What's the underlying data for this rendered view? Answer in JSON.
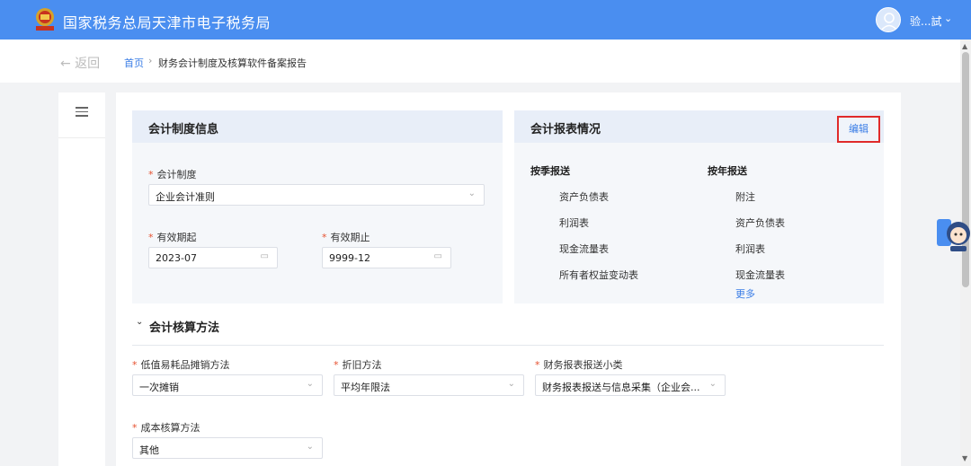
{
  "header": {
    "site_title": "国家税务总局天津市电子税务局",
    "username": "验...試",
    "brand_color": "#4a8ef0"
  },
  "breadcrumb": {
    "back_label": "← 返回",
    "home": "首页",
    "separator": "›",
    "current": "财务会计制度及核算软件备案报告"
  },
  "accounting_system": {
    "title": "会计制度信息",
    "system_label": "会计制度",
    "system_value": "企业会计准则",
    "start_label": "有效期起",
    "start_value": "2023-07",
    "end_label": "有效期止",
    "end_value": "9999-12"
  },
  "report_status": {
    "title": "会计报表情况",
    "edit_label": "编辑",
    "quarterly_head": "按季报送",
    "quarterly_items": [
      "资产负债表",
      "利润表",
      "现金流量表",
      "所有者权益变动表"
    ],
    "annual_head": "按年报送",
    "annual_items": [
      "附注",
      "资产负债表",
      "利润表",
      "现金流量表"
    ],
    "more_label": "更多"
  },
  "accounting_method": {
    "title": "会计核算方法",
    "low_value_label": "低值易耗品摊销方法",
    "low_value_value": "一次摊销",
    "depreciation_label": "折旧方法",
    "depreciation_value": "平均年限法",
    "report_type_label": "财务报表报送小类",
    "report_type_value": "财务报表报送与信息采集（企业会...",
    "cost_label": "成本核算方法",
    "cost_value": "其他"
  },
  "icons": {
    "emblem": "tax-emblem-icon",
    "menu": "menu-collapse-icon",
    "calendar": "calendar-icon",
    "dropdown": "chevron-down-icon",
    "assistant": "assistant-robot-icon"
  },
  "accent_colors": {
    "link": "#3a7de6",
    "required": "#e6502f",
    "highlight_border": "#e02a2a"
  }
}
